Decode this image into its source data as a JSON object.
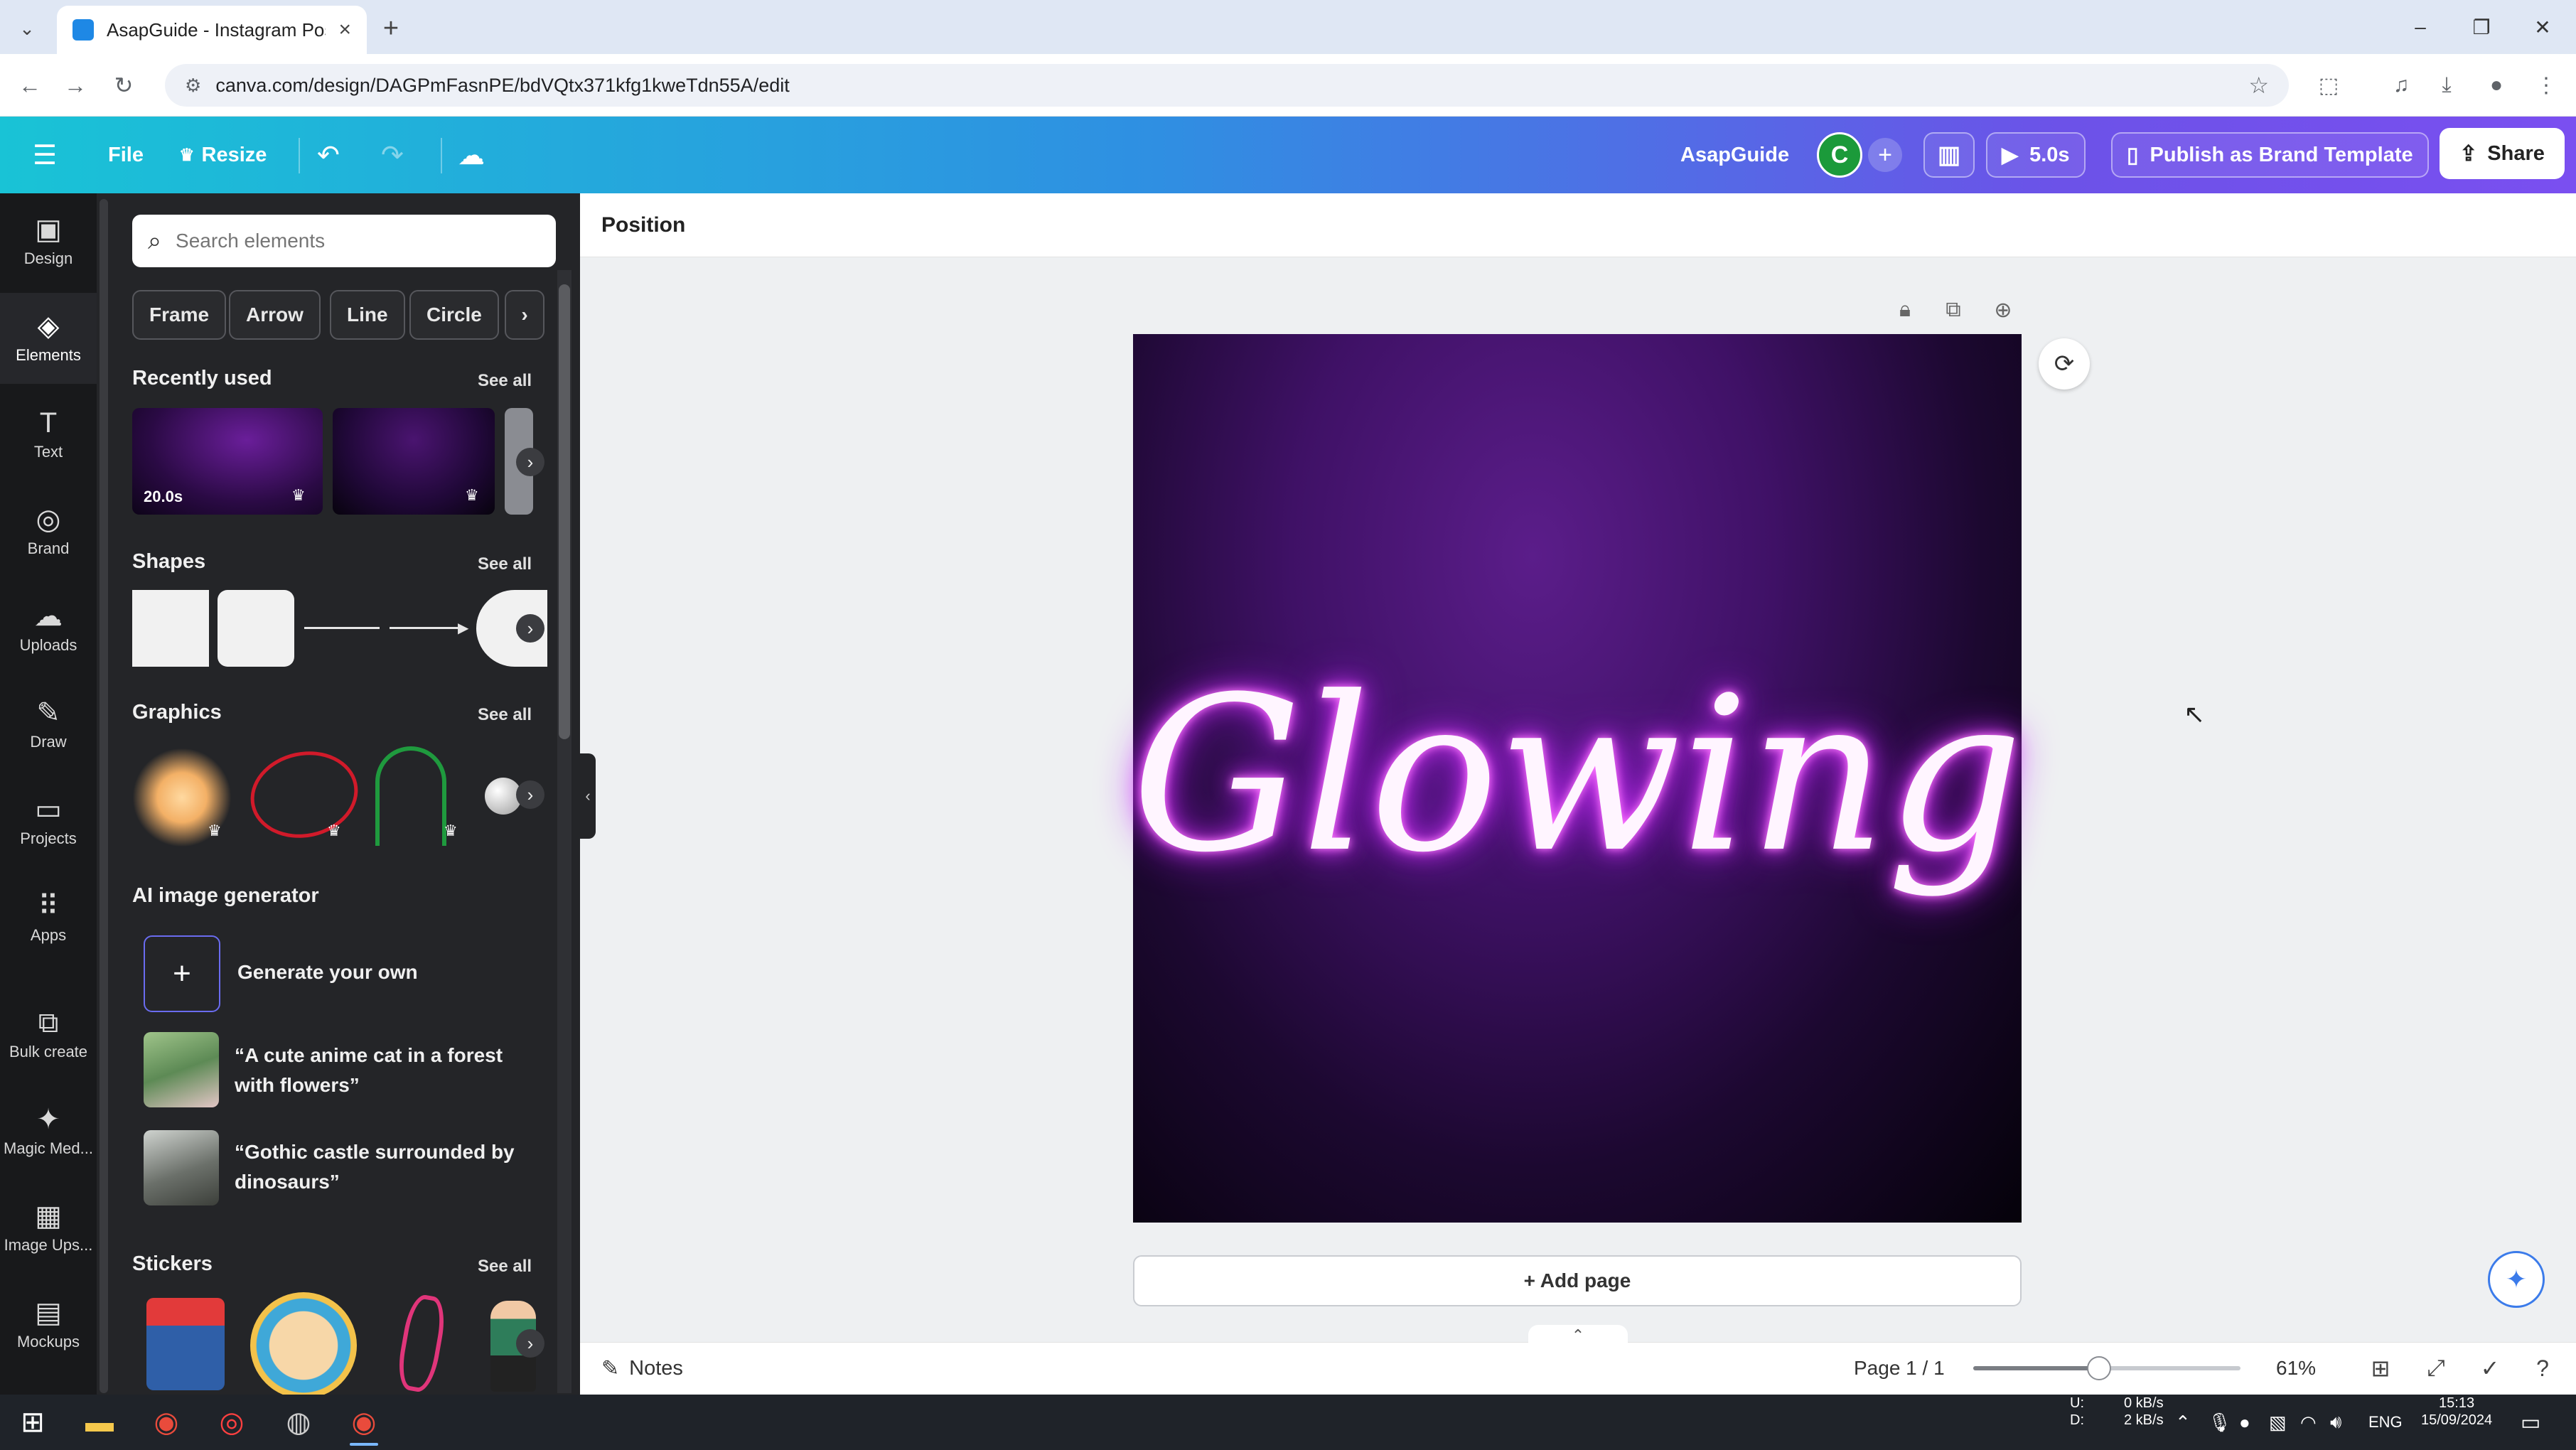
{
  "browser": {
    "tab_title": "AsapGuide - Instagram Post",
    "url": "canva.com/design/DAGPmFasnPE/bdVQtx371kfg1kweTdn55A/edit"
  },
  "header": {
    "file": "File",
    "resize": "Resize",
    "team_name": "AsapGuide",
    "avatar_initial": "C",
    "play_duration": "5.0s",
    "publish": "Publish as Brand Template",
    "share": "Share"
  },
  "rail": {
    "items": [
      {
        "label": "Design",
        "icon": "design-icon",
        "glyph": "▣"
      },
      {
        "label": "Elements",
        "icon": "elements-icon",
        "glyph": "◈"
      },
      {
        "label": "Text",
        "icon": "text-icon",
        "glyph": "T"
      },
      {
        "label": "Brand",
        "icon": "brand-icon",
        "glyph": "◎"
      },
      {
        "label": "Uploads",
        "icon": "uploads-icon",
        "glyph": "☁"
      },
      {
        "label": "Draw",
        "icon": "draw-icon",
        "glyph": "✎"
      },
      {
        "label": "Projects",
        "icon": "projects-icon",
        "glyph": "▭"
      },
      {
        "label": "Apps",
        "icon": "apps-icon",
        "glyph": "⠿"
      },
      {
        "label": "Bulk create",
        "icon": "bulk-create-icon",
        "glyph": "⧉"
      },
      {
        "label": "Magic Med...",
        "icon": "magic-media-icon",
        "glyph": "✦"
      },
      {
        "label": "Image Ups...",
        "icon": "image-upscaler-icon",
        "glyph": "▦"
      },
      {
        "label": "Mockups",
        "icon": "mockups-icon",
        "glyph": "▤"
      }
    ]
  },
  "panel": {
    "search_placeholder": "Search elements",
    "chips": [
      "Frame",
      "Arrow",
      "Line",
      "Circle"
    ],
    "recently_used": {
      "title": "Recently used",
      "see_all": "See all",
      "first_duration": "20.0s"
    },
    "shapes": {
      "title": "Shapes",
      "see_all": "See all"
    },
    "graphics": {
      "title": "Graphics",
      "see_all": "See all"
    },
    "ai": {
      "title": "AI image generator",
      "generate": "Generate your own",
      "prompt1": "“A cute anime cat in a forest with flowers”",
      "prompt2": "“Gothic castle surrounded by dinosaurs”"
    },
    "stickers": {
      "title": "Stickers",
      "see_all": "See all"
    }
  },
  "canvas": {
    "toolbar_label": "Position",
    "text": "Glowing",
    "add_page": "+ Add page"
  },
  "footer": {
    "notes": "Notes",
    "page_count": "Page 1 / 1",
    "zoom": "61%",
    "zoom_fraction": 0.47
  },
  "taskbar": {
    "net_up_label": "U:",
    "net_down_label": "D:",
    "net_up": "0 kB/s",
    "net_down": "2 kB/s",
    "lang": "ENG",
    "time": "15:13",
    "date": "15/09/2024"
  },
  "colors": {
    "header_start": "#19c3d6",
    "header_end": "#7a4ff0",
    "avatar": "#1b9a3a",
    "panel_bg": "#242528",
    "rail_bg": "#18191b",
    "glow": "#e040fb"
  }
}
